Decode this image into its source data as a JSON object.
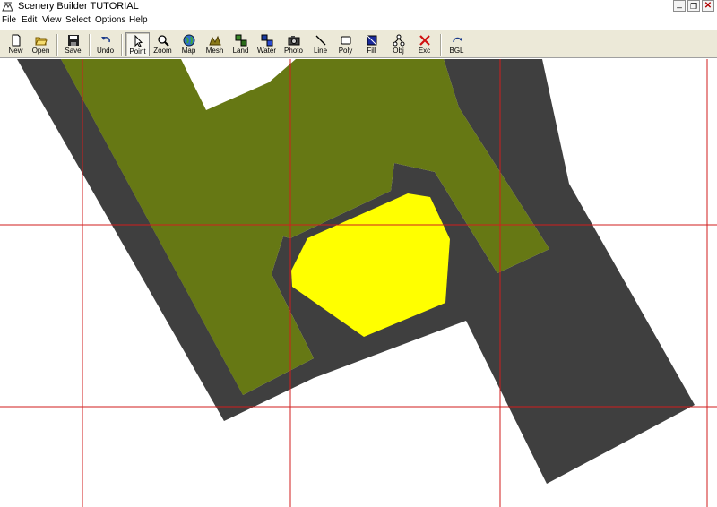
{
  "window": {
    "title": "Scenery Builder  TUTORIAL",
    "minimize": "_",
    "restore": "❐",
    "close": "✕"
  },
  "menu": [
    "File",
    "Edit",
    "View",
    "Select",
    "Options",
    "Help"
  ],
  "toolbar": {
    "new": "New",
    "open": "Open",
    "save": "Save",
    "undo": "Undo",
    "point": "Point",
    "zoom": "Zoom",
    "map": "Map",
    "mesh": "Mesh",
    "land": "Land",
    "water": "Water",
    "photo": "Photo",
    "line": "Line",
    "poly": "Poly",
    "fill": "Fill",
    "obj": "Obj",
    "exc": "Exc",
    "bgl": "BGL",
    "active_tool": "Point"
  },
  "colors": {
    "road": "#3f3f3f",
    "land": "#667814",
    "highlight": "#ffff00",
    "grid": "#d21e1e",
    "background": "#ffffff"
  }
}
